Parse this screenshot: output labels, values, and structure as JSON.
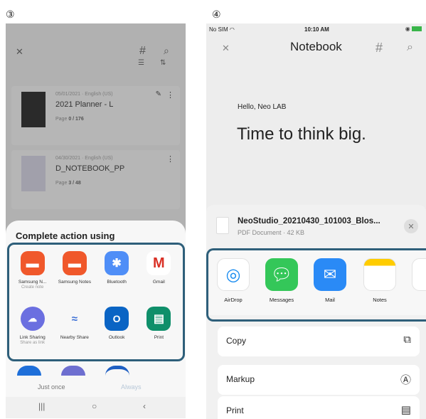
{
  "steps": {
    "android": "③",
    "ios": "④"
  },
  "android": {
    "notebooks": [
      {
        "date": "05/01/2021",
        "language": "English (US)",
        "title": "2021 Planner - L",
        "page_label": "Page",
        "page_value": "0 / 176"
      },
      {
        "date": "04/30/2021",
        "language": "English (US)",
        "title": "D_NOTEBOOK_PP",
        "page_label": "Page",
        "page_value": "3 / 48"
      }
    ],
    "sheet_title": "Complete action using",
    "apps": [
      {
        "label": "Samsung N...",
        "sub": "Create note",
        "icon": "samsung-notes-icon",
        "color": "#f0582b"
      },
      {
        "label": "Samsung Notes",
        "sub": "",
        "icon": "samsung-notes-icon",
        "color": "#f0582b"
      },
      {
        "label": "Bluetooth",
        "sub": "",
        "icon": "bluetooth-icon",
        "color": "#4f8ef7"
      },
      {
        "label": "Gmail",
        "sub": "",
        "icon": "gmail-icon",
        "color": "#ffffff"
      },
      {
        "label": "Link Sharing",
        "sub": "Share as link",
        "icon": "link-sharing-icon",
        "color": "#6b6fe0"
      },
      {
        "label": "Nearby Share",
        "sub": "",
        "icon": "nearby-share-icon",
        "color": "#ffffff"
      },
      {
        "label": "Outlook",
        "sub": "",
        "icon": "outlook-icon",
        "color": "#0a64c4"
      },
      {
        "label": "Print",
        "sub": "",
        "icon": "print-icon",
        "color": "#0f8f6a"
      }
    ],
    "just_once": "Just once",
    "always": "Always"
  },
  "ios": {
    "status": {
      "carrier": "No SIM",
      "time": "10:10 AM"
    },
    "nav_title": "Notebook",
    "hello": "Hello, Neo LAB",
    "headline": "Time to think big.",
    "file": {
      "name": "NeoStudio_20210430_101003_Blos...",
      "meta": "PDF Document · 42 KB"
    },
    "apps": [
      {
        "label": "AirDrop",
        "icon": "airdrop-icon"
      },
      {
        "label": "Messages",
        "icon": "messages-icon"
      },
      {
        "label": "Mail",
        "icon": "mail-icon"
      },
      {
        "label": "Notes",
        "icon": "notes-icon"
      }
    ],
    "actions": [
      {
        "label": "Copy",
        "icon": "copy-icon"
      },
      {
        "label": "Markup",
        "icon": "markup-icon"
      },
      {
        "label": "Print",
        "icon": "print-icon"
      }
    ]
  },
  "colors": {
    "highlight": "#2e5f7a"
  }
}
